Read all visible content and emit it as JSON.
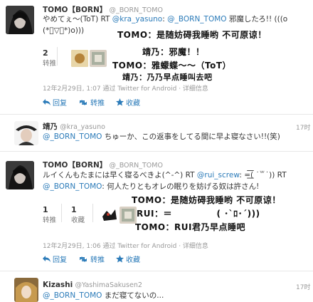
{
  "tweet1": {
    "name": "TOMO【BORN】",
    "handle": "@_BORN_TOMO",
    "text_line1_pre": "やめてぇ〜(ToT) RT ",
    "mention1": "@kra_yasuno",
    "text_line1_mid": ": ",
    "mention2": "@_BORN_TOMO",
    "text_line1_post": " 邪魔したろ!! (((o",
    "text_line2": "(*゚▽゚*)o)))",
    "retweet_count": "2",
    "retweet_label": "转推",
    "meta": "12年2月29日, 1:07 通过 Twitter for Android · 详细信息",
    "actions": {
      "reply": "回复",
      "retweet": "转推",
      "favorite": "收藏"
    },
    "annotations": [
      "TOMO：是随妨碍我睡哟 不可原谅！",
      "靖乃：邪魔！！",
      "TOMO：雅蠓蝶～～（ToT）",
      "靖乃：乃乃早点睡叫去吧"
    ]
  },
  "tweet2": {
    "name": "靖乃",
    "handle": "@kra_yasuno",
    "mention": "@_BORN_TOMO",
    "text": " ちゅーか、この返事をしてる間に早よ寝なさい!!(笑)",
    "time": "17时"
  },
  "tweet3": {
    "name": "TOMO【BORN】",
    "handle": "@_BORN_TOMO",
    "text_line1_pre": "ルイくんもたまには早く寝るべきよ(^-^) RT ",
    "mention1": "@rui_screw",
    "text_line1_post": ": =͟͟͞͞( ˙꒳˙)) RT",
    "mention2": "@_BORN_TOMO",
    "text_line2_post": ": 何人たりともオレの眠りを妨げる奴は許さん!",
    "retweet_count": "1",
    "retweet_label": "转推",
    "fav_count": "1",
    "fav_label": "收藏",
    "meta": "12年2月29日, 1:06 通过 Twitter for Android · 详细信息",
    "actions": {
      "reply": "回复",
      "retweet": "转推",
      "favorite": "收藏"
    },
    "annotations": [
      "TOMO：是随妨碍我睡哟 不可原谅！",
      "RUI：＝　　　　　( ･`ﾛ･´)))",
      "TOMO：RUI君乃早点睡吧"
    ]
  },
  "tweet4": {
    "name": "Kizashi",
    "handle": "@YashimaSakusen2",
    "mention": "@_BORN_TOMO",
    "text": " まだ寝てないの...",
    "time": "17时"
  },
  "colors": {
    "link": "#2b7bb9",
    "divider": "#e8e8e8"
  }
}
